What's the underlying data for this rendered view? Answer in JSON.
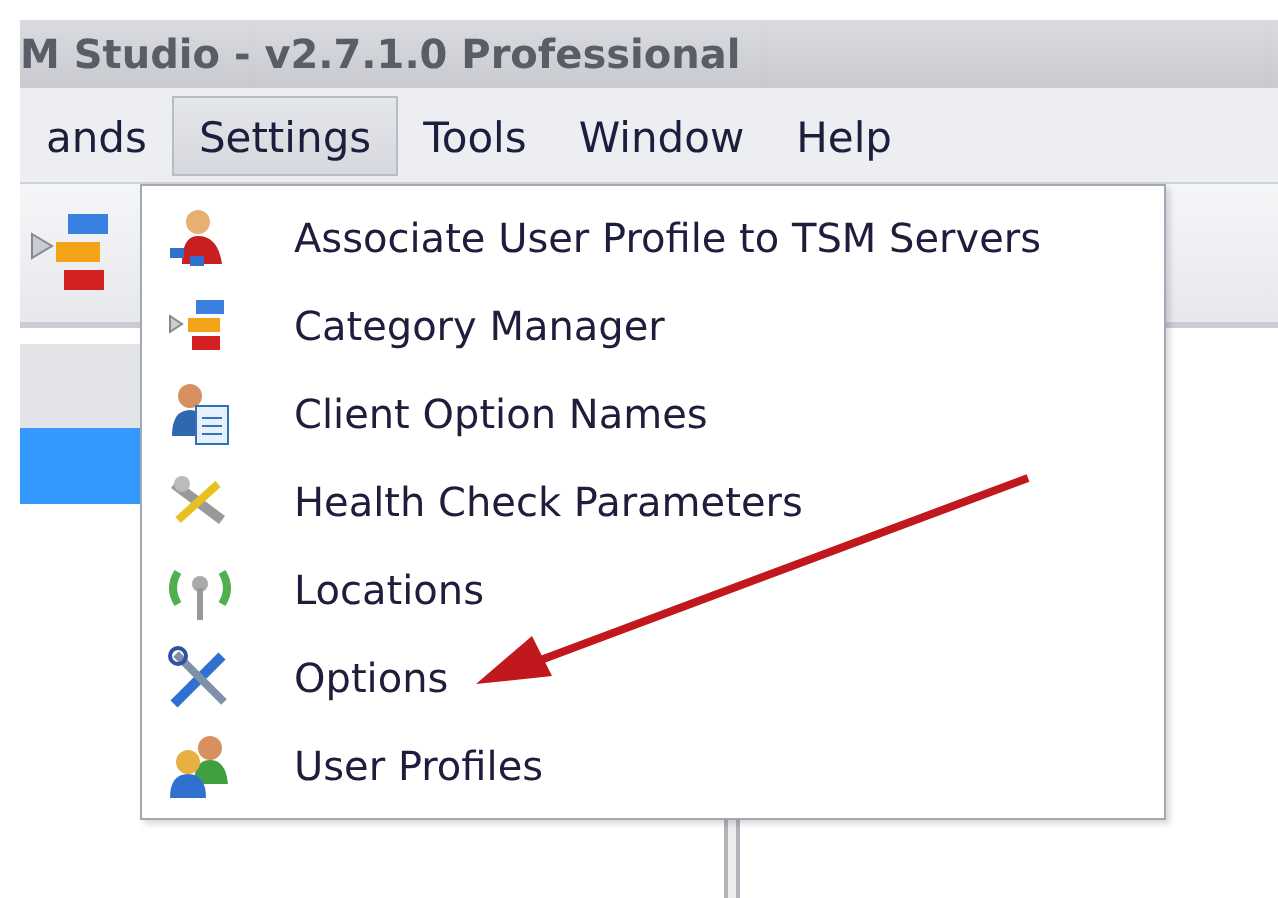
{
  "window": {
    "title": "M Studio - v2.7.1.0 Professional"
  },
  "menu_bar": [
    {
      "label": "ands",
      "selected": false
    },
    {
      "label": "Settings",
      "selected": true
    },
    {
      "label": "Tools",
      "selected": false
    },
    {
      "label": "Window",
      "selected": false
    },
    {
      "label": "Help",
      "selected": false
    }
  ],
  "settings_menu": {
    "items": [
      {
        "label": "Associate User Profile to TSM Servers"
      },
      {
        "label": "Category Manager"
      },
      {
        "label": "Client Option Names"
      },
      {
        "label": "Health Check Parameters"
      },
      {
        "label": "Locations"
      },
      {
        "label": "Options"
      },
      {
        "label": "User Profiles"
      }
    ]
  }
}
